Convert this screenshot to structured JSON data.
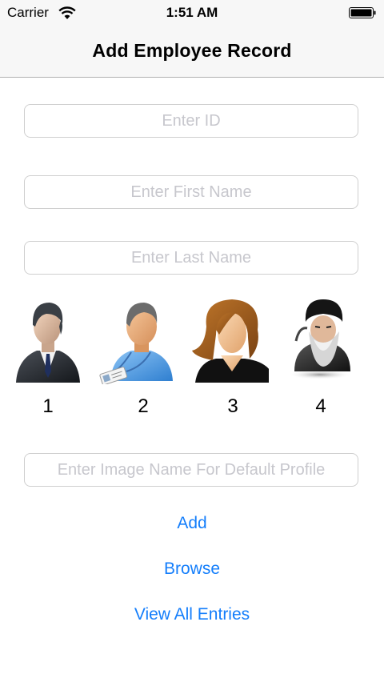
{
  "status_bar": {
    "carrier": "Carrier",
    "time": "1:51 AM"
  },
  "nav": {
    "title": "Add Employee Record"
  },
  "form": {
    "id_placeholder": "Enter ID",
    "first_name_placeholder": "Enter First Name",
    "last_name_placeholder": "Enter Last Name",
    "image_name_placeholder": "Enter Image Name For Default Profile"
  },
  "avatars": [
    {
      "label": "1",
      "icon": "businessman-avatar-icon"
    },
    {
      "label": "2",
      "icon": "employee-badge-avatar-icon"
    },
    {
      "label": "3",
      "icon": "woman-avatar-icon"
    },
    {
      "label": "4",
      "icon": "bearded-cleric-avatar-icon"
    }
  ],
  "actions": {
    "add": "Add",
    "browse": "Browse",
    "view_all": "View All Entries"
  },
  "colors": {
    "tint": "#147efb",
    "placeholder": "#c7c7cd",
    "border": "#cfcfcf"
  }
}
